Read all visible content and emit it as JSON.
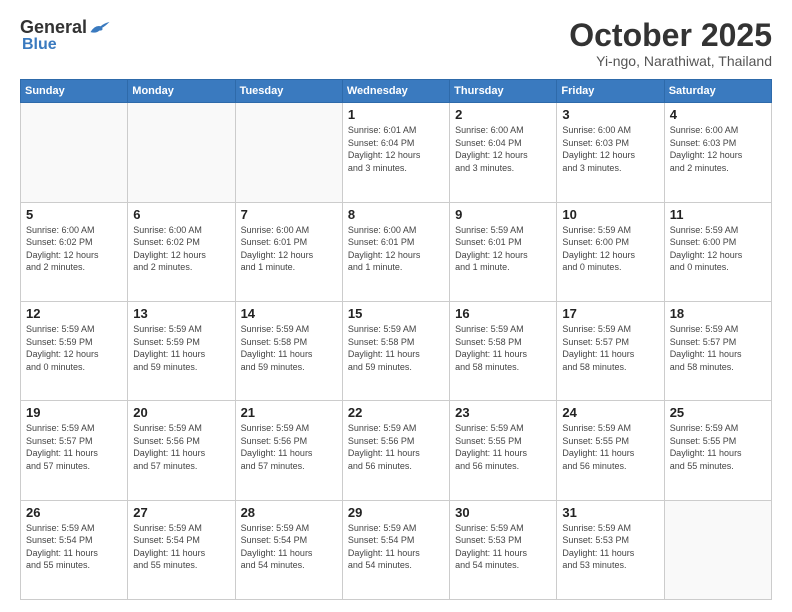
{
  "header": {
    "logo_general": "General",
    "logo_blue": "Blue",
    "month_title": "October 2025",
    "subtitle": "Yi-ngo, Narathiwat, Thailand"
  },
  "weekdays": [
    "Sunday",
    "Monday",
    "Tuesday",
    "Wednesday",
    "Thursday",
    "Friday",
    "Saturday"
  ],
  "weeks": [
    [
      {
        "day": "",
        "info": ""
      },
      {
        "day": "",
        "info": ""
      },
      {
        "day": "",
        "info": ""
      },
      {
        "day": "1",
        "info": "Sunrise: 6:01 AM\nSunset: 6:04 PM\nDaylight: 12 hours\nand 3 minutes."
      },
      {
        "day": "2",
        "info": "Sunrise: 6:00 AM\nSunset: 6:04 PM\nDaylight: 12 hours\nand 3 minutes."
      },
      {
        "day": "3",
        "info": "Sunrise: 6:00 AM\nSunset: 6:03 PM\nDaylight: 12 hours\nand 3 minutes."
      },
      {
        "day": "4",
        "info": "Sunrise: 6:00 AM\nSunset: 6:03 PM\nDaylight: 12 hours\nand 2 minutes."
      }
    ],
    [
      {
        "day": "5",
        "info": "Sunrise: 6:00 AM\nSunset: 6:02 PM\nDaylight: 12 hours\nand 2 minutes."
      },
      {
        "day": "6",
        "info": "Sunrise: 6:00 AM\nSunset: 6:02 PM\nDaylight: 12 hours\nand 2 minutes."
      },
      {
        "day": "7",
        "info": "Sunrise: 6:00 AM\nSunset: 6:01 PM\nDaylight: 12 hours\nand 1 minute."
      },
      {
        "day": "8",
        "info": "Sunrise: 6:00 AM\nSunset: 6:01 PM\nDaylight: 12 hours\nand 1 minute."
      },
      {
        "day": "9",
        "info": "Sunrise: 5:59 AM\nSunset: 6:01 PM\nDaylight: 12 hours\nand 1 minute."
      },
      {
        "day": "10",
        "info": "Sunrise: 5:59 AM\nSunset: 6:00 PM\nDaylight: 12 hours\nand 0 minutes."
      },
      {
        "day": "11",
        "info": "Sunrise: 5:59 AM\nSunset: 6:00 PM\nDaylight: 12 hours\nand 0 minutes."
      }
    ],
    [
      {
        "day": "12",
        "info": "Sunrise: 5:59 AM\nSunset: 5:59 PM\nDaylight: 12 hours\nand 0 minutes."
      },
      {
        "day": "13",
        "info": "Sunrise: 5:59 AM\nSunset: 5:59 PM\nDaylight: 11 hours\nand 59 minutes."
      },
      {
        "day": "14",
        "info": "Sunrise: 5:59 AM\nSunset: 5:58 PM\nDaylight: 11 hours\nand 59 minutes."
      },
      {
        "day": "15",
        "info": "Sunrise: 5:59 AM\nSunset: 5:58 PM\nDaylight: 11 hours\nand 59 minutes."
      },
      {
        "day": "16",
        "info": "Sunrise: 5:59 AM\nSunset: 5:58 PM\nDaylight: 11 hours\nand 58 minutes."
      },
      {
        "day": "17",
        "info": "Sunrise: 5:59 AM\nSunset: 5:57 PM\nDaylight: 11 hours\nand 58 minutes."
      },
      {
        "day": "18",
        "info": "Sunrise: 5:59 AM\nSunset: 5:57 PM\nDaylight: 11 hours\nand 58 minutes."
      }
    ],
    [
      {
        "day": "19",
        "info": "Sunrise: 5:59 AM\nSunset: 5:57 PM\nDaylight: 11 hours\nand 57 minutes."
      },
      {
        "day": "20",
        "info": "Sunrise: 5:59 AM\nSunset: 5:56 PM\nDaylight: 11 hours\nand 57 minutes."
      },
      {
        "day": "21",
        "info": "Sunrise: 5:59 AM\nSunset: 5:56 PM\nDaylight: 11 hours\nand 57 minutes."
      },
      {
        "day": "22",
        "info": "Sunrise: 5:59 AM\nSunset: 5:56 PM\nDaylight: 11 hours\nand 56 minutes."
      },
      {
        "day": "23",
        "info": "Sunrise: 5:59 AM\nSunset: 5:55 PM\nDaylight: 11 hours\nand 56 minutes."
      },
      {
        "day": "24",
        "info": "Sunrise: 5:59 AM\nSunset: 5:55 PM\nDaylight: 11 hours\nand 56 minutes."
      },
      {
        "day": "25",
        "info": "Sunrise: 5:59 AM\nSunset: 5:55 PM\nDaylight: 11 hours\nand 55 minutes."
      }
    ],
    [
      {
        "day": "26",
        "info": "Sunrise: 5:59 AM\nSunset: 5:54 PM\nDaylight: 11 hours\nand 55 minutes."
      },
      {
        "day": "27",
        "info": "Sunrise: 5:59 AM\nSunset: 5:54 PM\nDaylight: 11 hours\nand 55 minutes."
      },
      {
        "day": "28",
        "info": "Sunrise: 5:59 AM\nSunset: 5:54 PM\nDaylight: 11 hours\nand 54 minutes."
      },
      {
        "day": "29",
        "info": "Sunrise: 5:59 AM\nSunset: 5:54 PM\nDaylight: 11 hours\nand 54 minutes."
      },
      {
        "day": "30",
        "info": "Sunrise: 5:59 AM\nSunset: 5:53 PM\nDaylight: 11 hours\nand 54 minutes."
      },
      {
        "day": "31",
        "info": "Sunrise: 5:59 AM\nSunset: 5:53 PM\nDaylight: 11 hours\nand 53 minutes."
      },
      {
        "day": "",
        "info": ""
      }
    ]
  ]
}
